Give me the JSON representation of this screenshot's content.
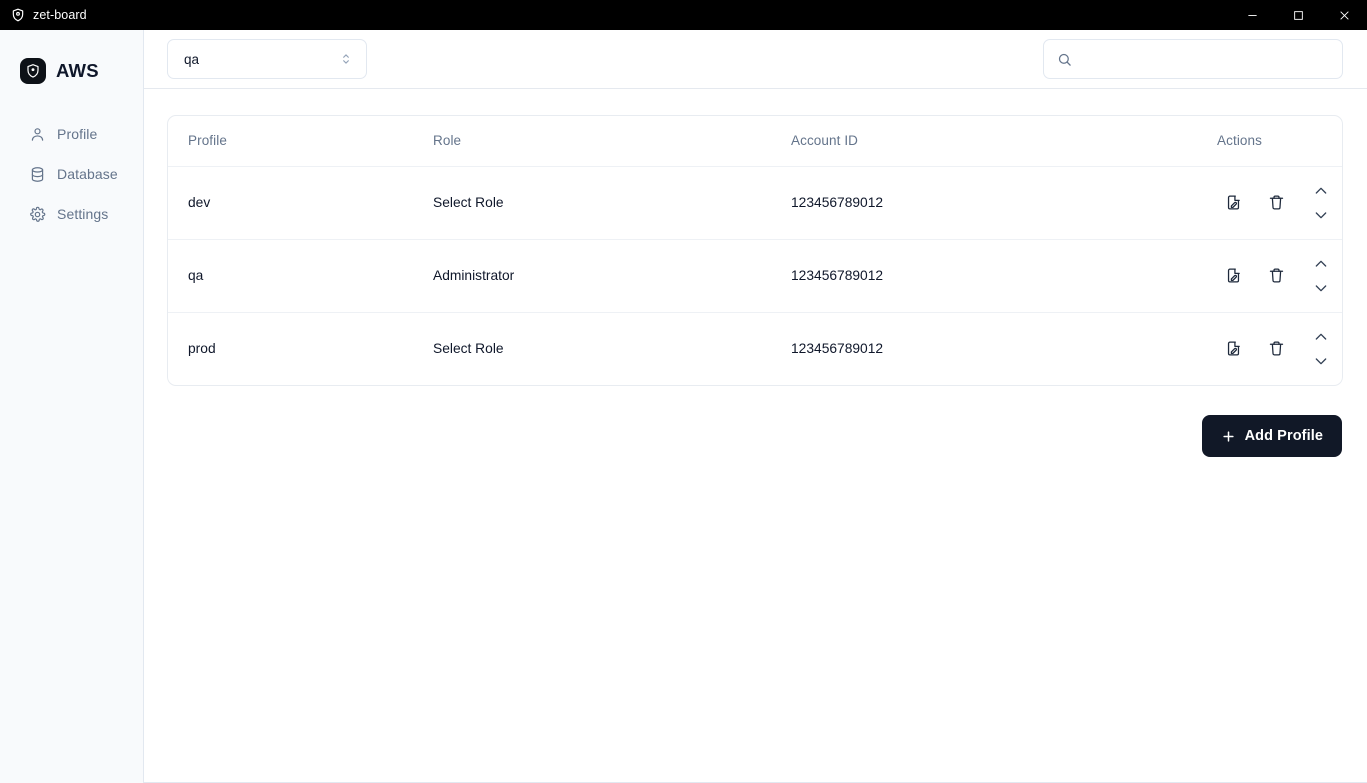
{
  "window": {
    "title": "zet-board",
    "app_icon": "shield-icon",
    "controls": {
      "minimize": "minimize-icon",
      "maximize": "maximize-icon",
      "close": "close-icon"
    }
  },
  "sidebar": {
    "brand": {
      "name": "AWS",
      "logo_icon": "aws-shield-logo-icon"
    },
    "items": [
      {
        "label": "Profile",
        "icon": "user-icon"
      },
      {
        "label": "Database",
        "icon": "database-icon"
      },
      {
        "label": "Settings",
        "icon": "gear-icon"
      }
    ]
  },
  "toolbar": {
    "profile_select": {
      "value": "qa",
      "icon": "chevrons-up-down-icon"
    },
    "search": {
      "value": "",
      "placeholder": "",
      "icon": "search-icon"
    }
  },
  "table": {
    "columns": [
      "Profile",
      "Role",
      "Account ID",
      "Actions"
    ],
    "rows": [
      {
        "profile": "dev",
        "role": "Select Role",
        "account_id": "123456789012"
      },
      {
        "profile": "qa",
        "role": "Administrator",
        "account_id": "123456789012"
      },
      {
        "profile": "prod",
        "role": "Select Role",
        "account_id": "123456789012"
      }
    ],
    "row_actions": {
      "edit_icon": "file-pen-icon",
      "delete_icon": "trash-icon",
      "move_up_icon": "chevron-up-icon",
      "move_down_icon": "chevron-down-icon"
    }
  },
  "footer": {
    "add_profile_label": "Add Profile",
    "add_profile_icon": "plus-icon"
  },
  "colors": {
    "titlebar_bg": "#000000",
    "sidebar_bg": "#f8fafc",
    "content_bg": "#ffffff",
    "border": "#e2e8f0",
    "muted_text": "#64748b",
    "primary_text": "#0f172a",
    "button_bg": "#111827"
  }
}
